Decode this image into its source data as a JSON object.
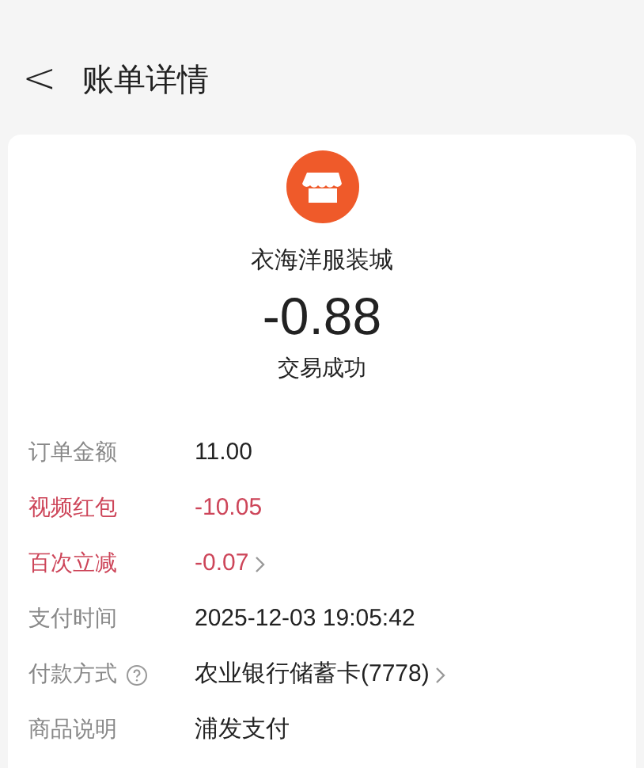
{
  "header": {
    "back": "<",
    "title": "账单详情"
  },
  "merchant": {
    "name": "衣海洋服装城",
    "amount": "-0.88",
    "status": "交易成功"
  },
  "rows": [
    {
      "label": "订单金额",
      "value": "11.00",
      "kind": "plain",
      "link": false,
      "help": false
    },
    {
      "label": "视频红包",
      "value": "-10.05",
      "kind": "discount",
      "link": false,
      "help": false
    },
    {
      "label": "百次立减",
      "value": "-0.07",
      "kind": "discount",
      "link": true,
      "help": false
    },
    {
      "label": "支付时间",
      "value": "2025-12-03 19:05:42",
      "kind": "plain",
      "link": false,
      "help": false
    },
    {
      "label": "付款方式",
      "value": "农业银行储蓄卡(7778)",
      "kind": "plain",
      "link": true,
      "help": true
    },
    {
      "label": "商品说明",
      "value": "浦发支付",
      "kind": "plain",
      "link": false,
      "help": false
    }
  ]
}
